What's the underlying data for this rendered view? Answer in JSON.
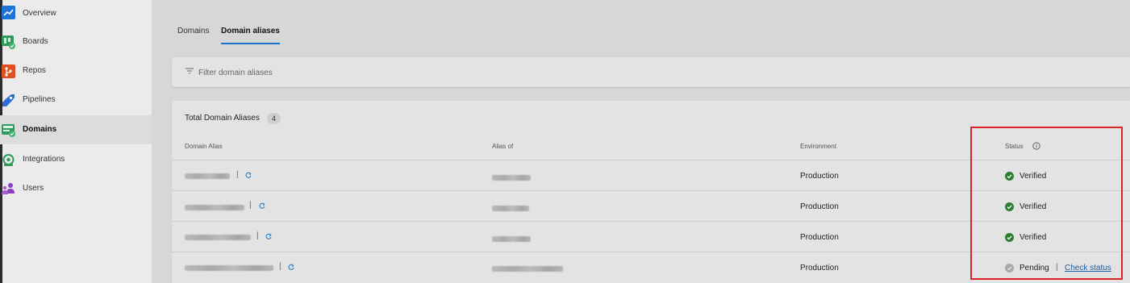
{
  "sidebar": {
    "items": [
      {
        "label": "Overview",
        "icon": "overview-icon",
        "active": false
      },
      {
        "label": "Boards",
        "icon": "boards-icon",
        "active": false
      },
      {
        "label": "Repos",
        "icon": "repos-icon",
        "active": false
      },
      {
        "label": "Pipelines",
        "icon": "pipelines-icon",
        "active": false
      },
      {
        "label": "Domains",
        "icon": "domains-icon",
        "active": true
      },
      {
        "label": "Integrations",
        "icon": "integrations-icon",
        "active": false
      },
      {
        "label": "Users",
        "icon": "users-icon",
        "active": false
      }
    ]
  },
  "tabs": [
    {
      "label": "Domains",
      "active": false
    },
    {
      "label": "Domain aliases",
      "active": true
    }
  ],
  "filter": {
    "placeholder": "Filter domain aliases"
  },
  "table": {
    "title": "Total Domain Aliases",
    "count": "4",
    "columns": {
      "domain_alias": "Domain Alias",
      "alias_of": "Alias of",
      "environment": "Environment",
      "status": "Status"
    },
    "separator": "|",
    "rows": [
      {
        "environment": "Production",
        "status": "Verified",
        "status_kind": "verified"
      },
      {
        "environment": "Production",
        "status": "Verified",
        "status_kind": "verified"
      },
      {
        "environment": "Production",
        "status": "Verified",
        "status_kind": "verified"
      },
      {
        "environment": "Production",
        "status": "Pending",
        "status_kind": "pending",
        "action": "Check status"
      }
    ]
  },
  "colors": {
    "accent": "#1a73c4",
    "verified": "#2e7d32",
    "pending": "#a8a8a8",
    "highlight": "#d9232a",
    "link": "#1a5fa8"
  }
}
